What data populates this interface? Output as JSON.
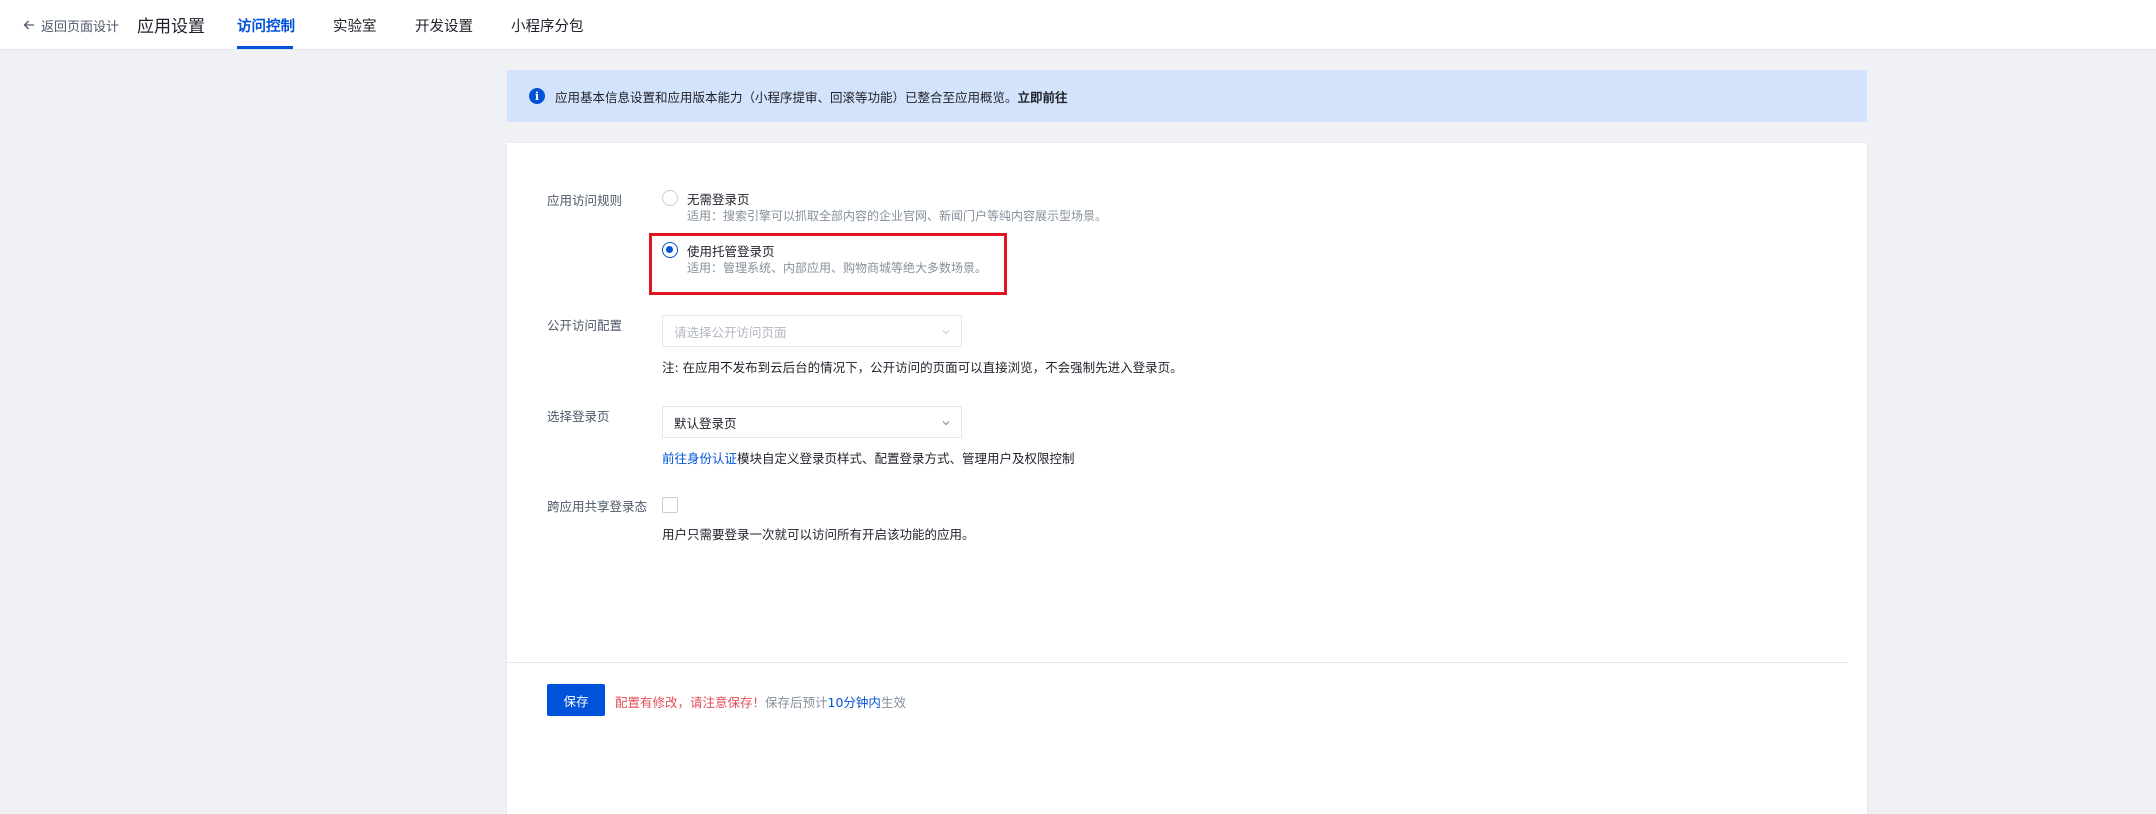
{
  "header": {
    "back_label": "返回页面设计",
    "app_title": "应用设置",
    "tabs": [
      {
        "label": "访问控制",
        "active": true
      },
      {
        "label": "实验室",
        "active": false
      },
      {
        "label": "开发设置",
        "active": false
      },
      {
        "label": "小程序分包",
        "active": false
      }
    ]
  },
  "notice": {
    "icon": "info-icon",
    "text": "应用基本信息设置和应用版本能力（小程序提审、回滚等功能）已整合至应用概览。",
    "link": "立即前往"
  },
  "form": {
    "access_rule": {
      "label": "应用访问规则",
      "options": [
        {
          "title": "无需登录页",
          "desc": "适用：搜索引擎可以抓取全部内容的企业官网、新闻门户等纯内容展示型场景。",
          "checked": false
        },
        {
          "title": "使用托管登录页",
          "desc": "适用：管理系统、内部应用、购物商城等绝大多数场景。",
          "checked": true
        }
      ]
    },
    "public_access": {
      "label": "公开访问配置",
      "placeholder": "请选择公开访问页面",
      "note": "注: 在应用不发布到云后台的情况下，公开访问的页面可以直接浏览，不会强制先进入登录页。"
    },
    "login_page": {
      "label": "选择登录页",
      "value": "默认登录页",
      "note_link": "前往身份认证",
      "note_text": "模块自定义登录页样式、配置登录方式、管理用户及权限控制"
    },
    "shared_login": {
      "label": "跨应用共享登录态",
      "checked": false,
      "note": "用户只需要登录一次就可以访问所有开启该功能的应用。"
    }
  },
  "footer": {
    "save_label": "保存",
    "hint_warning": "配置有修改，请注意保存！",
    "hint_prefix": "保存后预计",
    "hint_time": "10分钟内",
    "hint_suffix": "生效"
  },
  "colors": {
    "primary": "#0052d9",
    "warning": "#e34d59",
    "highlight_box": "#e0141e",
    "notice_bg": "#d4e3fc"
  }
}
